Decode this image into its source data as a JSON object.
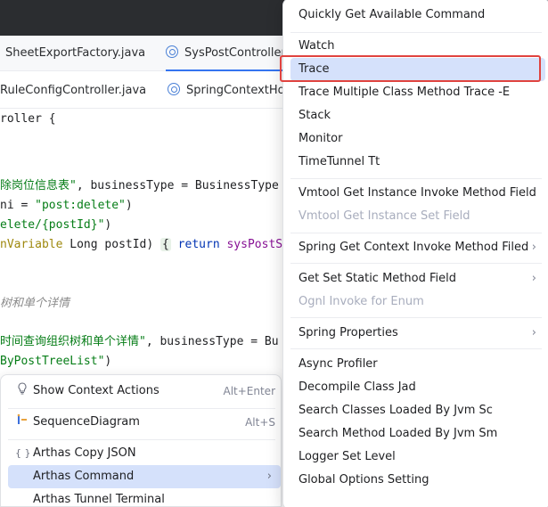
{
  "tabs_row1": [
    {
      "label": "SheetExportFactory.java",
      "icon": "none"
    },
    {
      "label": "SysPostController.ja",
      "icon": "class-icon",
      "active": true
    }
  ],
  "tabs_row2": [
    {
      "label": "RuleConfigController.java",
      "icon": "none"
    },
    {
      "label": "SpringContextHold",
      "icon": "class-icon"
    }
  ],
  "code": {
    "l1": "roller {",
    "l2a": "除岗位信息表\"",
    "l2b": ", businessType = BusinessType",
    "l3a": "ni = ",
    "l3b": "\"post:delete\"",
    "l3c": ")",
    "l4a": "elete/{postId}\"",
    "l4b": ")",
    "l5a": "nVariable",
    "l5b": " Long postId) ",
    "l5c": "{",
    "l5d": " return ",
    "l5e": "sysPostS",
    "l6": "树和单个详情",
    "l7a": "时间查询组织树和单个详情\"",
    "l7b": ", businessType = Bu",
    "l8a": "ByPostTreeList\"",
    "l8b": ")"
  },
  "context_menu": {
    "items": [
      {
        "label": "Show Context Actions",
        "shortcut": "Alt+Enter",
        "icon": "lightbulb-icon"
      },
      {
        "label": "SequenceDiagram",
        "shortcut": "Alt+S",
        "icon": "sequence-diagram-icon"
      },
      {
        "label": "Arthas Copy JSON",
        "shortcut": "",
        "icon": "braces-icon"
      },
      {
        "label": "Arthas Command",
        "shortcut": "",
        "icon": "",
        "submenu": true,
        "selected": true
      },
      {
        "label": "Arthas Tunnel Terminal",
        "shortcut": "",
        "icon": ""
      }
    ],
    "arrow": "›"
  },
  "arthas_menu": {
    "items": [
      {
        "label": "Quickly Get Available Command",
        "disabled": false
      },
      {
        "label": "Watch",
        "disabled": false
      },
      {
        "label": "Trace",
        "disabled": false,
        "highlighted": true
      },
      {
        "label": "Trace Multiple Class Method Trace -E",
        "disabled": false
      },
      {
        "label": "Stack",
        "disabled": false
      },
      {
        "label": "Monitor",
        "disabled": false
      },
      {
        "label": "TimeTunnel Tt",
        "disabled": false
      },
      {
        "label": "Vmtool Get Instance Invoke Method Field",
        "disabled": false
      },
      {
        "label": "Vmtool Get Instance Set Field",
        "disabled": true
      },
      {
        "label": "Spring Get Context Invoke Method Filed",
        "disabled": false,
        "submenu": true
      },
      {
        "label": "Get Set Static Method Field",
        "disabled": false,
        "submenu": true
      },
      {
        "label": "Ognl Invoke for Enum",
        "disabled": true
      },
      {
        "label": "Spring Properties",
        "disabled": false,
        "submenu": true
      },
      {
        "label": "Async Profiler",
        "disabled": false
      },
      {
        "label": "Decompile Class Jad",
        "disabled": false
      },
      {
        "label": "Search Classes Loaded By Jvm Sc",
        "disabled": false
      },
      {
        "label": "Search Method Loaded By Jvm Sm",
        "disabled": false
      },
      {
        "label": "Logger Set Level",
        "disabled": false
      },
      {
        "label": "Global Options Setting",
        "disabled": false
      }
    ],
    "arrow": "›"
  },
  "colors": {
    "highlight": "#d5e1fb",
    "annotation_box": "#e0433f",
    "accent": "#3574f0"
  }
}
